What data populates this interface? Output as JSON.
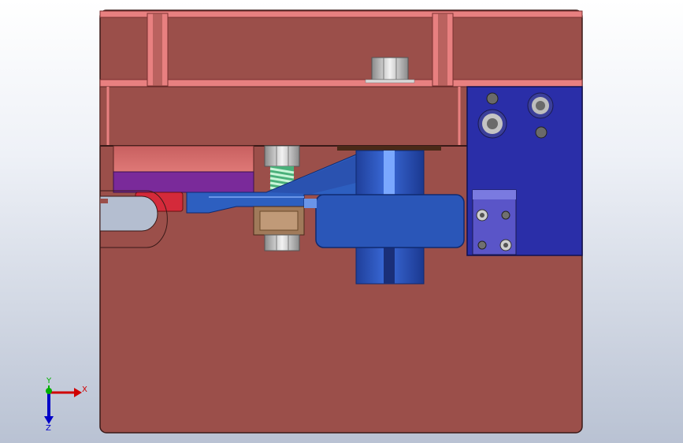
{
  "viewport": {
    "background_top": "#ffffff",
    "background_bottom": "#b9c2d3"
  },
  "model": {
    "colors": {
      "die_plate": "#9b4f4a",
      "die_plate_edge": "#3a1a18",
      "rib": "#e88080",
      "cylinder": "#d46a68",
      "cylinder_band": "#7a2a9a",
      "spring": "#7fd8a0",
      "bracket": "#2f3fb5",
      "lever": "#2d5fc0",
      "shaft": "#3260c8",
      "nut": "#cfcfcf",
      "block": "#a07a5a",
      "red_block": "#d42a3a"
    }
  },
  "triad": {
    "x_label": "X",
    "y_label": "Y",
    "z_label": "Z",
    "x_color": "#d00000",
    "y_color": "#00b000",
    "z_color": "#0000c8"
  }
}
